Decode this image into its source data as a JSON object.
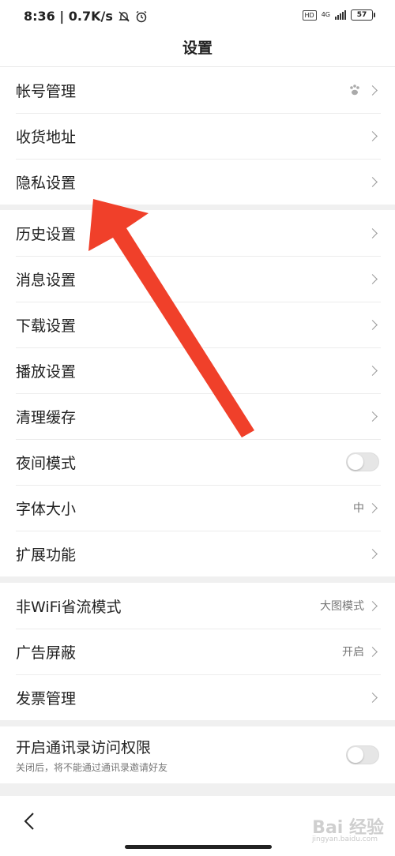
{
  "status_bar": {
    "time_speed": "8:36 | 0.7K/s",
    "hd": "HD",
    "network": "4G",
    "battery": "57"
  },
  "header": {
    "title": "设置"
  },
  "group1": [
    {
      "label": "帐号管理",
      "icon": "paw-icon"
    },
    {
      "label": "收货地址"
    },
    {
      "label": "隐私设置"
    }
  ],
  "group2": [
    {
      "label": "历史设置"
    },
    {
      "label": "消息设置"
    },
    {
      "label": "下载设置"
    },
    {
      "label": "播放设置"
    },
    {
      "label": "清理缓存"
    },
    {
      "label": "夜间模式",
      "toggle": false
    },
    {
      "label": "字体大小",
      "value": "中"
    },
    {
      "label": "扩展功能"
    }
  ],
  "group3": [
    {
      "label": "非WiFi省流模式",
      "value": "大图模式"
    },
    {
      "label": "广告屏蔽",
      "value": "开启"
    },
    {
      "label": "发票管理"
    }
  ],
  "group4": {
    "label": "开启通讯录访问权限",
    "sub": "关闭后，将不能通过通讯录邀请好友",
    "toggle": false
  },
  "watermark": {
    "main": "Bai 经验",
    "sub": "jingyan.baidu.com"
  },
  "colors": {
    "annotation_arrow": "#f0402a",
    "background": "#f0f0f0",
    "card": "#ffffff"
  }
}
